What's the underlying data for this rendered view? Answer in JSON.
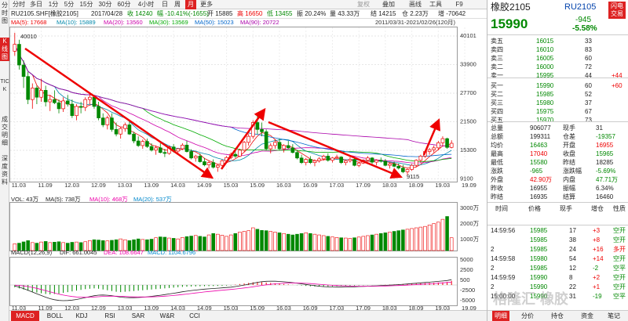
{
  "side_tabs": [
    {
      "label": "分时图",
      "active": false
    },
    {
      "label": "K线图",
      "active": true
    },
    {
      "label": "TICK",
      "active": false
    },
    {
      "label": "成交明细",
      "active": false
    },
    {
      "label": "深度资料",
      "active": false
    }
  ],
  "toolbar": {
    "periods": [
      "分时",
      "多日",
      "1分",
      "5分",
      "15分",
      "30分",
      "60分",
      "4小时",
      "日",
      "周",
      "月",
      "更多"
    ],
    "active_period": "月",
    "right_items": [
      "复权",
      "叠加",
      "画线",
      "工具",
      "F9"
    ]
  },
  "info_bar": {
    "code": "RU2105.SHF[橡胶2105]",
    "date": "2017/04/28",
    "price": "收 14240",
    "change": "幅 -10.41%(-1655)",
    "open": "开 15885",
    "high": "高 16650",
    "low": "低 13455",
    "amplitude": "振 20.24%",
    "amount": "量 43.33万",
    "settle": "结 14215",
    "hold": "仓 2.23万",
    "hold_change": "增 -70642"
  },
  "ma_legend": {
    "ma5": "MA(5): 17668",
    "ma10": "MA(10): 15889",
    "ma20": "MA(20): 13560",
    "ma30": "MA(30): 13569",
    "ma50": "MA(50): 15023",
    "ma90": "MA(90): 20722"
  },
  "date_range": "2011/03/31-2021/02/26(120月)",
  "price_annotations": {
    "high": "40010",
    "low": "9115"
  },
  "y_axis_main": [
    "40101",
    "33900",
    "27700",
    "21500",
    "15300",
    "9100"
  ],
  "volume_legend": {
    "vol": "VOL: 43万",
    "ma5": "MA(5): 738万",
    "ma10": "MA(10): 468万",
    "ma20": "MA(20): 537万"
  },
  "y_axis_vol": [
    "3000万",
    "2000万",
    "1000万"
  ],
  "macd_legend": {
    "macd": "MACD(12,26,9)",
    "dif": "DIF: 661.0045",
    "dea": "DEA: 108.6647",
    "macd_val": "MACD: 1104.6796"
  },
  "y_axis_macd": [
    "5000",
    "2500",
    "500",
    "-2500",
    "-5000"
  ],
  "x_axis": [
    "11.03",
    "11.09",
    "12.03",
    "12.09",
    "13.03",
    "13.09",
    "14.03",
    "14.09",
    "15.03",
    "15.09",
    "16.03",
    "16.09",
    "17.03",
    "17.09",
    "18.03",
    "18.09",
    "19.03",
    "19.09",
    "20.03",
    "20.09"
  ],
  "bottom_tabs": [
    "MACD",
    "BOLL",
    "KDJ",
    "RSI",
    "SAR",
    "W&R",
    "CCI"
  ],
  "active_bottom_tab": "MACD",
  "chart_data": {
    "type": "candlestick",
    "candles": [
      [
        36000,
        40010,
        35000,
        37500
      ],
      [
        37500,
        38500,
        32000,
        33000
      ],
      [
        33000,
        34000,
        28000,
        30500
      ],
      [
        30500,
        31500,
        24500,
        25500
      ],
      [
        25500,
        29000,
        23500,
        28000
      ],
      [
        28000,
        28500,
        24500,
        26000
      ],
      [
        26000,
        30000,
        25000,
        27500
      ],
      [
        27500,
        28500,
        24000,
        25000
      ],
      [
        25000,
        26500,
        23000,
        25500
      ],
      [
        25500,
        27500,
        24500,
        24800
      ],
      [
        24800,
        25500,
        22500,
        23500
      ],
      [
        23500,
        26000,
        22800,
        25200
      ],
      [
        25200,
        26500,
        24000,
        24500
      ],
      [
        24500,
        25500,
        21500,
        22000
      ],
      [
        22000,
        24500,
        21000,
        24000
      ],
      [
        24000,
        25000,
        22500,
        23800
      ],
      [
        23800,
        26000,
        23000,
        25500
      ],
      [
        25500,
        27000,
        24500,
        26000
      ],
      [
        26000,
        26500,
        23500,
        24000
      ],
      [
        24000,
        25000,
        21000,
        21500
      ],
      [
        21500,
        22500,
        19500,
        20000
      ],
      [
        20000,
        22000,
        19000,
        21500
      ],
      [
        21500,
        22500,
        18500,
        19000
      ],
      [
        19000,
        20500,
        17500,
        18000
      ],
      [
        18000,
        19500,
        17000,
        19200
      ],
      [
        19200,
        20500,
        18500,
        20000
      ],
      [
        20000,
        20800,
        17800,
        18000
      ],
      [
        18000,
        18500,
        16000,
        16500
      ],
      [
        16500,
        17500,
        15200,
        15500
      ],
      [
        15500,
        16800,
        14800,
        16400
      ],
      [
        16400,
        17000,
        15000,
        15300
      ],
      [
        15300,
        16000,
        14200,
        14500
      ],
      [
        14500,
        15500,
        13500,
        15000
      ],
      [
        15000,
        16000,
        13800,
        14000
      ],
      [
        14000,
        14800,
        13000,
        13800
      ],
      [
        13800,
        15500,
        13500,
        15200
      ],
      [
        15200,
        15800,
        14000,
        14300
      ],
      [
        14300,
        15000,
        13500,
        14800
      ],
      [
        14800,
        16000,
        14500,
        15600
      ],
      [
        15600,
        16500,
        14000,
        14200
      ],
      [
        14200,
        14700,
        12500,
        12800
      ],
      [
        12800,
        13500,
        12000,
        13200
      ],
      [
        13200,
        13800,
        11800,
        12000
      ],
      [
        12000,
        12800,
        11000,
        11300
      ],
      [
        11300,
        12200,
        10500,
        11800
      ],
      [
        11800,
        12500,
        10500,
        10800
      ],
      [
        10800,
        11500,
        9800,
        11200
      ],
      [
        11200,
        12500,
        11000,
        12200
      ],
      [
        12200,
        13200,
        11800,
        12900
      ],
      [
        12900,
        14000,
        12500,
        13600
      ],
      [
        13600,
        14500,
        12800,
        13200
      ],
      [
        13200,
        14800,
        13000,
        14500
      ],
      [
        14500,
        16500,
        14200,
        16200
      ],
      [
        16200,
        18000,
        15500,
        17500
      ],
      [
        17500,
        21000,
        17000,
        20500
      ],
      [
        20500,
        22000,
        18000,
        19000
      ],
      [
        19000,
        20500,
        17500,
        18500
      ],
      [
        18500,
        19000,
        14500,
        14800
      ],
      [
        14800,
        16000,
        13800,
        15500
      ],
      [
        15500,
        16800,
        14800,
        16200
      ],
      [
        16200,
        17000,
        14500,
        14800
      ],
      [
        14800,
        15800,
        14000,
        15500
      ],
      [
        15500,
        16500,
        14800,
        15000
      ],
      [
        15000,
        15800,
        13800,
        14000
      ],
      [
        14000,
        14500,
        12500,
        12800
      ],
      [
        12800,
        13500,
        11500,
        11800
      ],
      [
        11800,
        12800,
        11200,
        12500
      ],
      [
        12500,
        13200,
        11500,
        11800
      ],
      [
        11800,
        12500,
        11000,
        12200
      ],
      [
        12200,
        13000,
        11800,
        12600
      ],
      [
        12600,
        13500,
        12200,
        13200
      ],
      [
        13200,
        13800,
        12000,
        12300
      ],
      [
        12300,
        13000,
        11800,
        12800
      ],
      [
        12800,
        13500,
        12500,
        13000
      ],
      [
        13000,
        13200,
        11500,
        11800
      ],
      [
        11800,
        12500,
        11200,
        12200
      ],
      [
        12200,
        13000,
        11800,
        12500
      ],
      [
        12500,
        12800,
        11000,
        11200
      ],
      [
        11200,
        12000,
        10800,
        11700
      ],
      [
        11700,
        12500,
        11500,
        12300
      ],
      [
        12300,
        13200,
        12000,
        12800
      ],
      [
        12800,
        13000,
        11500,
        11900
      ],
      [
        11900,
        12500,
        11200,
        12300
      ],
      [
        12300,
        12900,
        11800,
        12100
      ],
      [
        12100,
        12600,
        11000,
        11200
      ],
      [
        11200,
        11800,
        10500,
        11500
      ],
      [
        11500,
        12000,
        10800,
        11000
      ],
      [
        11000,
        11600,
        10300,
        10600
      ],
      [
        10600,
        11300,
        9500,
        9800
      ],
      [
        9800,
        10500,
        9115,
        10300
      ],
      [
        10300,
        11500,
        10000,
        11200
      ],
      [
        11200,
        12500,
        10800,
        12300
      ],
      [
        12300,
        13500,
        11800,
        13200
      ],
      [
        13200,
        14500,
        12800,
        14200
      ],
      [
        14200,
        15000,
        13500,
        14600
      ],
      [
        14600,
        15500,
        14000,
        15000
      ],
      [
        15000,
        16500,
        14500,
        16100
      ],
      [
        16100,
        17500,
        15500,
        17000
      ],
      [
        17000,
        17200,
        14800,
        15100
      ],
      [
        15100,
        16650,
        14900,
        15990
      ]
    ],
    "volume": [
      480,
      520,
      610,
      700,
      560,
      520,
      600,
      640,
      560,
      590,
      620,
      560,
      520,
      580,
      600,
      560,
      620,
      700,
      760,
      740,
      700,
      680,
      720,
      760,
      820,
      760,
      700,
      760,
      820,
      780,
      760,
      800,
      900,
      960,
      940,
      880,
      860,
      820,
      920,
      980,
      1020,
      1060,
      1000,
      960,
      1100,
      1200,
      1150,
      1080,
      1000,
      1100,
      1200,
      1300,
      1350,
      1400,
      1600,
      1500,
      1420,
      1400,
      1350,
      1300,
      1250,
      1200,
      1150,
      1100,
      1150,
      1200,
      1250,
      1200,
      1150,
      1100,
      1050,
      1000,
      960,
      920,
      900,
      880,
      860,
      900,
      950,
      1000,
      1050,
      1100,
      1150,
      1200,
      1250,
      1300,
      1350,
      1400,
      1450,
      1500,
      1550,
      1600,
      1650,
      1700,
      1800,
      1900,
      2000,
      2200,
      2400,
      900
    ],
    "macd_hist": [
      -600,
      -900,
      -1200,
      -1500,
      -1800,
      -2000,
      -2200,
      -2400,
      -2500,
      -2400,
      -2300,
      -2100,
      -1900,
      -1700,
      -1500,
      -1300,
      -1100,
      -1000,
      -900,
      -1000,
      -1200,
      -1400,
      -1600,
      -1800,
      -1900,
      -1800,
      -1700,
      -1600,
      -1500,
      -1400,
      -1300,
      -1200,
      -1100,
      -1000,
      -900,
      -800,
      -700,
      -600,
      -500,
      -450,
      -400,
      -380,
      -350,
      -320,
      -300,
      -280,
      -250,
      -200,
      -150,
      -100,
      100,
      250,
      400,
      550,
      700,
      800,
      750,
      650,
      550,
      450,
      350,
      250,
      150,
      50,
      -50,
      -150,
      -250,
      -350,
      -400,
      -420,
      -400,
      -380,
      -350,
      -300,
      -260,
      -220,
      -180,
      -150,
      -120,
      -90,
      -60,
      -30,
      0,
      30,
      60,
      100,
      150,
      200,
      250,
      300,
      350,
      400,
      450,
      500,
      550,
      600,
      650,
      700,
      800,
      1104
    ]
  },
  "right_panel": {
    "name": "橡胶2105",
    "code": "RU2105",
    "trade_btn": "闪电交易",
    "price": "15990",
    "change": "-945",
    "change_pct": "-5.58%",
    "asks": [
      {
        "label": "卖五",
        "price": "16015",
        "vol": "33",
        "chg": ""
      },
      {
        "label": "卖四",
        "price": "16010",
        "vol": "83",
        "chg": ""
      },
      {
        "label": "卖三",
        "price": "16005",
        "vol": "60",
        "chg": ""
      },
      {
        "label": "卖二",
        "price": "16000",
        "vol": "72",
        "chg": ""
      },
      {
        "label": "卖一",
        "price": "15995",
        "vol": "44",
        "chg": "+44"
      }
    ],
    "bids": [
      {
        "label": "买一",
        "price": "15990",
        "vol": "60",
        "chg": "+60"
      },
      {
        "label": "买二",
        "price": "15985",
        "vol": "52",
        "chg": ""
      },
      {
        "label": "买三",
        "price": "15980",
        "vol": "37",
        "chg": ""
      },
      {
        "label": "买四",
        "price": "15975",
        "vol": "67",
        "chg": ""
      },
      {
        "label": "买五",
        "price": "15970",
        "vol": "73",
        "chg": ""
      }
    ],
    "stats": [
      {
        "l1": "总量",
        "v1": "906077",
        "l2": "现手",
        "v2": "31",
        "c1": "blk",
        "c2": "blk"
      },
      {
        "l1": "总额",
        "v1": "199311",
        "l2": "仓差",
        "v2": "-19357",
        "c1": "blk",
        "c2": "green"
      },
      {
        "l1": "均价",
        "v1": "16463",
        "l2": "开盘",
        "v2": "16955",
        "c1": "green",
        "c2": "red"
      },
      {
        "l1": "最高",
        "v1": "17040",
        "l2": "收盘",
        "v2": "15965",
        "c1": "red",
        "c2": "green"
      },
      {
        "l1": "最低",
        "v1": "15580",
        "l2": "昨结",
        "v2": "18285",
        "c1": "green",
        "c2": "blk"
      },
      {
        "l1": "涨跌",
        "v1": "-965",
        "l2": "涨跌幅",
        "v2": "-5.69%",
        "c1": "green",
        "c2": "green"
      },
      {
        "l1": "外盘",
        "v1": "42.90万",
        "l2": "内盘",
        "v2": "47.71万",
        "c1": "red",
        "c2": "green"
      },
      {
        "l1": "昨收",
        "v1": "16955",
        "l2": "振幅",
        "v2": "6.34%",
        "c1": "blk",
        "c2": "blk"
      },
      {
        "l1": "昨结",
        "v1": "16935",
        "l2": "结算",
        "v2": "16460",
        "c1": "blk",
        "c2": "blk"
      }
    ],
    "tick_headers": [
      "时间",
      "价格",
      "现手",
      "增仓",
      "性质"
    ],
    "ticks": [
      {
        "time": "14:59:56",
        "price": "15985",
        "vol": "17",
        "inc": "+3",
        "nature": "空开"
      },
      {
        "time": "",
        "price": "15985",
        "vol": "38",
        "inc": "+8",
        "nature": "空开"
      },
      {
        "time": "2",
        "price": "15985",
        "vol": "24",
        "inc": "+16",
        "nature": "多开"
      },
      {
        "time": "14:59:58",
        "price": "15980",
        "vol": "54",
        "inc": "+14",
        "nature": "空开"
      },
      {
        "time": "2",
        "price": "15985",
        "vol": "12",
        "inc": "-2",
        "nature": "空平"
      },
      {
        "time": "14:59:59",
        "price": "15990",
        "vol": "8",
        "inc": "+2",
        "nature": "空开"
      },
      {
        "time": "2",
        "price": "15990",
        "vol": "22",
        "inc": "+1",
        "nature": "空开"
      },
      {
        "time": "15:00:00",
        "price": "15990",
        "vol": "31",
        "inc": "-19",
        "nature": "空平"
      }
    ],
    "bottom_tabs": [
      "明细",
      "分价",
      "持仓",
      "资金",
      "笔记"
    ],
    "active_tab": "明细",
    "watermark": "格隆汇·橡胶"
  }
}
